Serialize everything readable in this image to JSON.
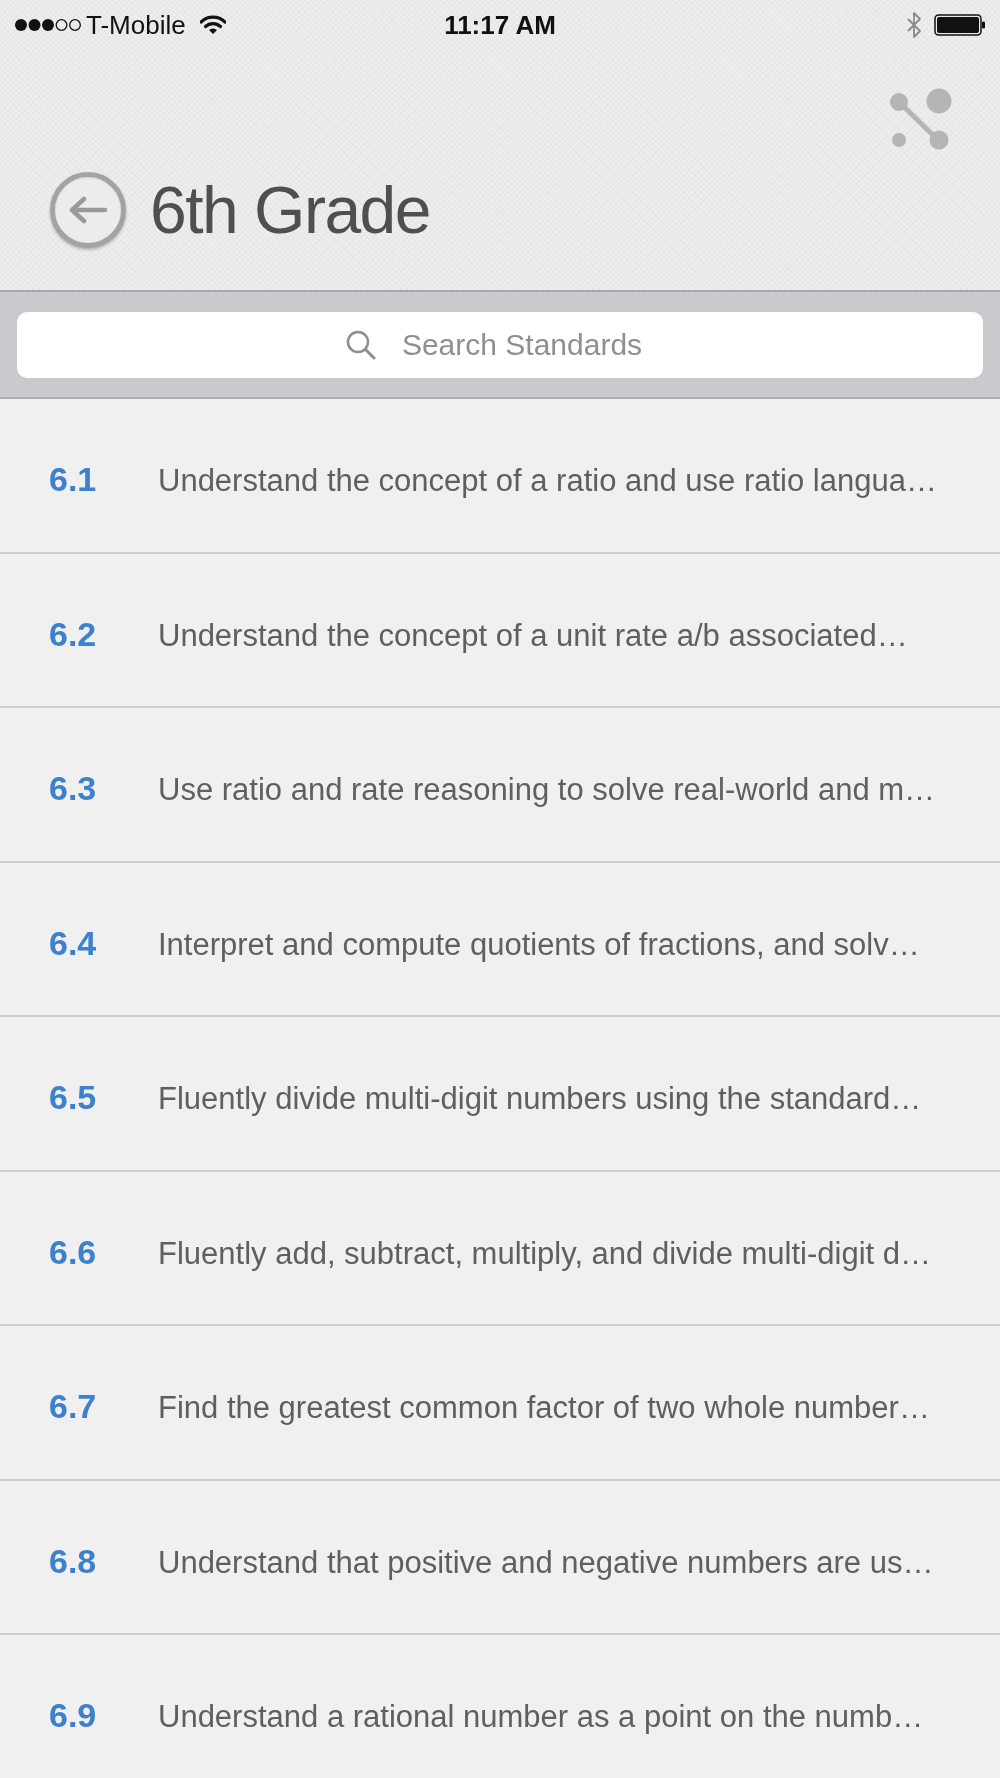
{
  "status_bar": {
    "carrier": "T-Mobile",
    "time": "11:17 AM"
  },
  "header": {
    "title": "6th Grade"
  },
  "search": {
    "placeholder": "Search Standards"
  },
  "standards": [
    {
      "code": "6.1",
      "text": "Understand the concept of a ratio and use ratio langua…"
    },
    {
      "code": "6.2",
      "text": "Understand the concept of a unit rate a/b associated…"
    },
    {
      "code": "6.3",
      "text": "Use ratio and rate reasoning to solve real-world and m…"
    },
    {
      "code": "6.4",
      "text": "Interpret and compute quotients of fractions, and solv…"
    },
    {
      "code": "6.5",
      "text": "Fluently divide multi-digit numbers using the standard…"
    },
    {
      "code": "6.6",
      "text": "Fluently add, subtract, multiply, and divide multi-digit d…"
    },
    {
      "code": "6.7",
      "text": "Find the greatest common factor of two whole number…"
    },
    {
      "code": "6.8",
      "text": "Understand that positive and negative numbers are us…"
    },
    {
      "code": "6.9",
      "text": "Understand a rational number as a point on the numb…"
    }
  ]
}
